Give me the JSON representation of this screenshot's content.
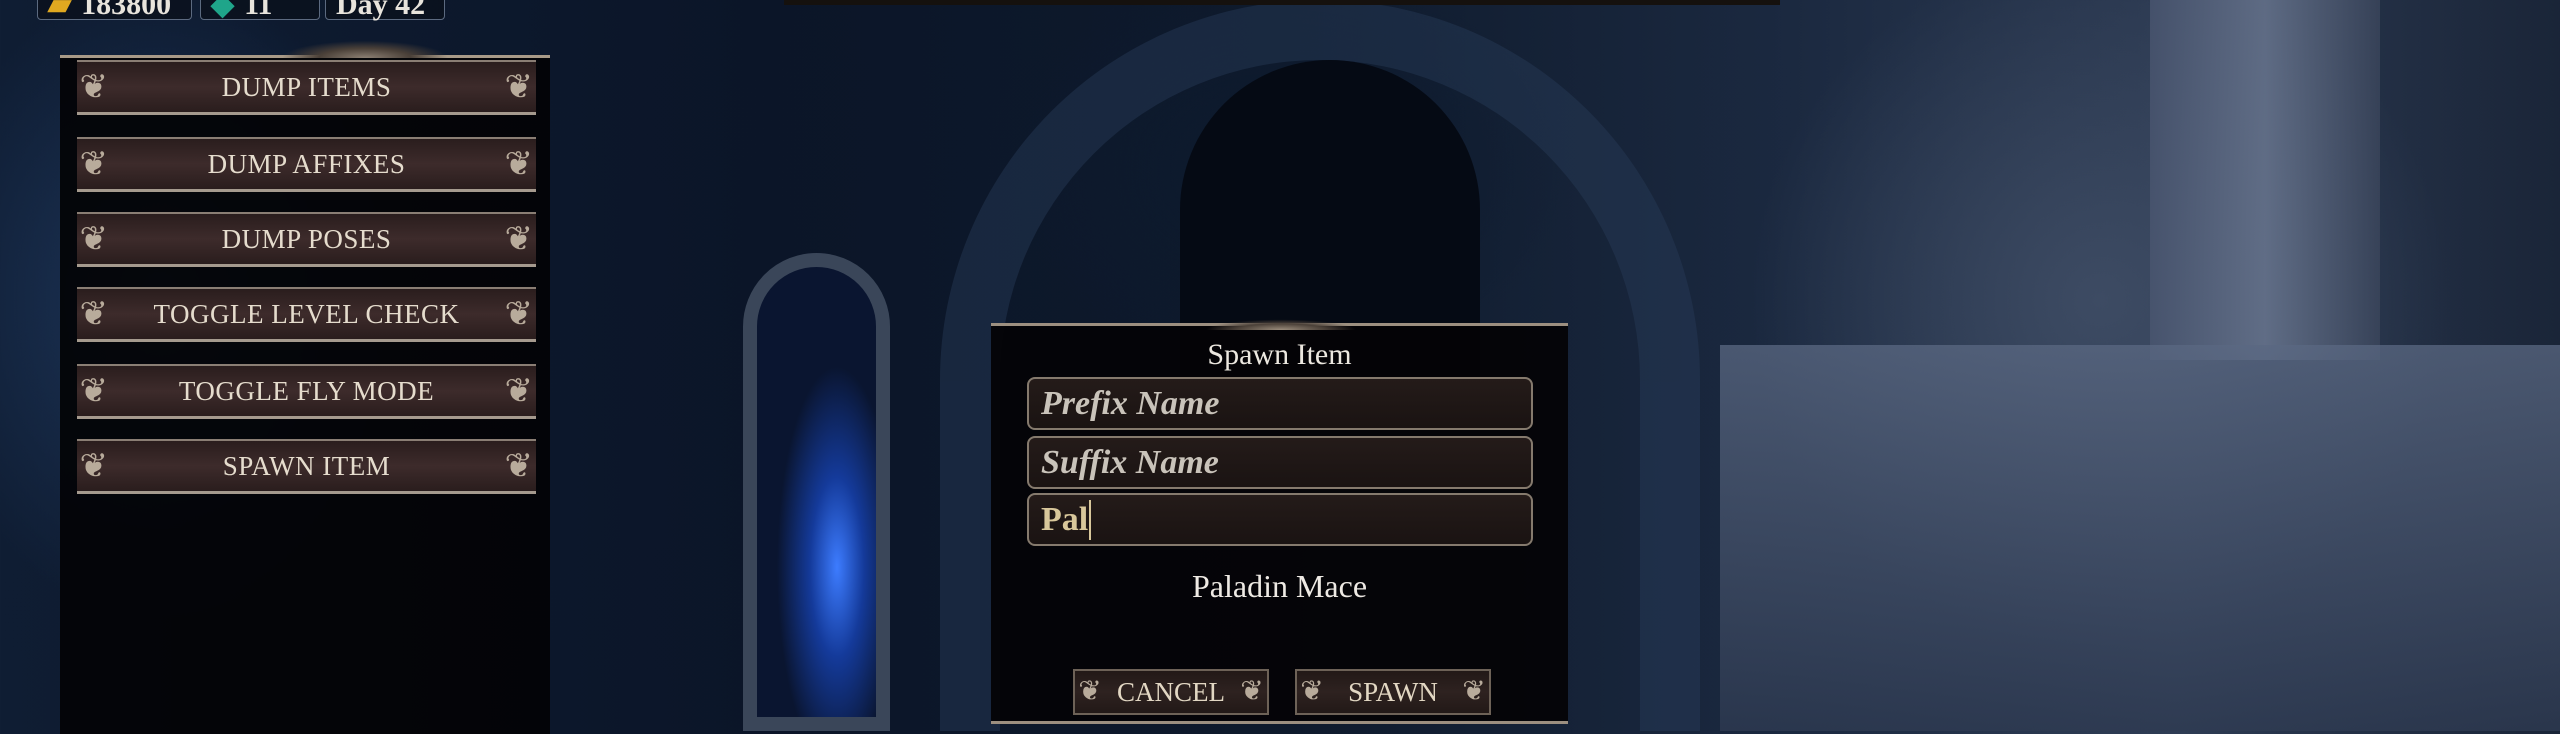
{
  "hud": {
    "gold": "183800",
    "gems": "11",
    "day": "Day 42",
    "gold_icon": "gold-bar-icon",
    "gem_icon": "gem-icon"
  },
  "debug_menu": {
    "buttons": [
      {
        "label": "DUMP ITEMS"
      },
      {
        "label": "DUMP AFFIXES"
      },
      {
        "label": "DUMP POSES"
      },
      {
        "label": "TOGGLE LEVEL CHECK"
      },
      {
        "label": "TOGGLE FLY MODE"
      },
      {
        "label": "SPAWN ITEM"
      }
    ]
  },
  "spawn_dialog": {
    "title": "Spawn Item",
    "prefix_placeholder": "Prefix Name",
    "suffix_placeholder": "Suffix Name",
    "item_value": "Pal",
    "match_result": "Paladin Mace",
    "cancel_label": "CANCEL",
    "spawn_label": "SPAWN"
  },
  "colors": {
    "accent_text": "#d8c79b",
    "panel_border": "#a59a8e",
    "button_bg": "#3d2b2b"
  }
}
